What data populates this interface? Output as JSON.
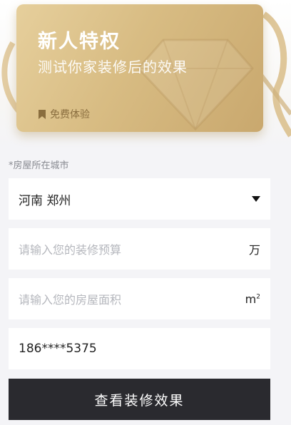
{
  "card": {
    "title": "新人特权",
    "subtitle": "测试你家装修后的效果",
    "free_label": "免费体验"
  },
  "form": {
    "city_label": "*房屋所在城市",
    "city_value": "河南 郑州",
    "budget_placeholder": "请输入您的装修预算",
    "budget_unit": "万",
    "area_placeholder": "请输入您的房屋面积",
    "area_unit": "m",
    "area_unit_sup": "2",
    "phone_value": "186****5375"
  },
  "submit_label": "查看装修效果",
  "colors": {
    "card_gold": "#d8bc83",
    "button_dark": "#2a2a2f",
    "page_bg": "#f4f4f7"
  }
}
